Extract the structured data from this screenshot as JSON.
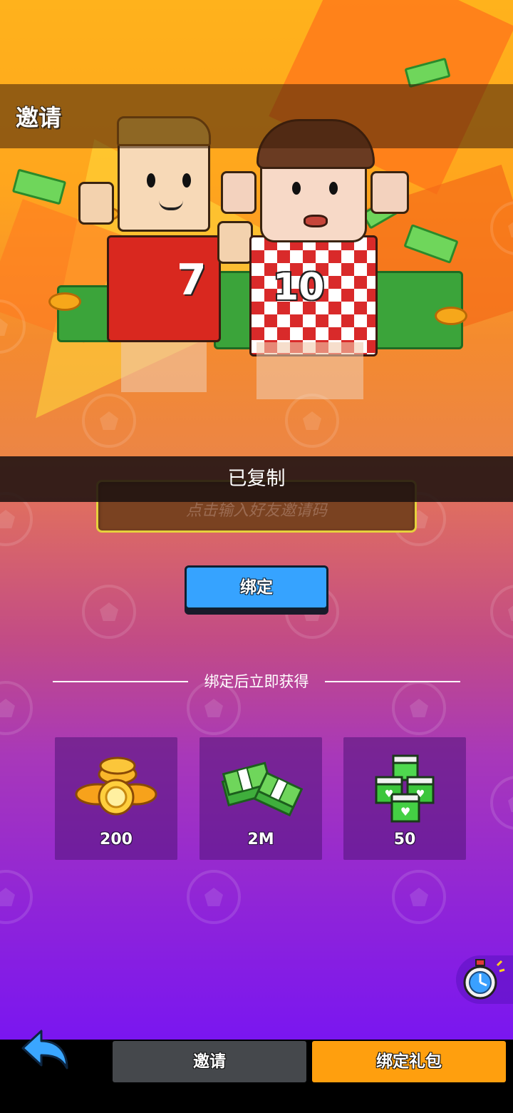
{
  "header": {
    "title": "邀请"
  },
  "toast": {
    "text": "已复制"
  },
  "invite_code_input": {
    "value": "",
    "placeholder": "点击输入好友邀请码"
  },
  "bind_button": {
    "label": "绑定"
  },
  "rewards": {
    "title": "绑定后立即获得",
    "items": [
      {
        "icon": "gold-coins-icon",
        "amount": "200"
      },
      {
        "icon": "cash-stack-icon",
        "amount": "2M"
      },
      {
        "icon": "green-heart-cubes-icon",
        "amount": "50"
      }
    ]
  },
  "tabs": [
    {
      "label": "邀请",
      "selected": false
    },
    {
      "label": "绑定礼包",
      "selected": true
    }
  ],
  "colors": {
    "bind_button": "#36a3ff",
    "selected_tab": "#ff9f0e",
    "unselected_tab": "#45484c",
    "input_border": "#e6d13c"
  }
}
